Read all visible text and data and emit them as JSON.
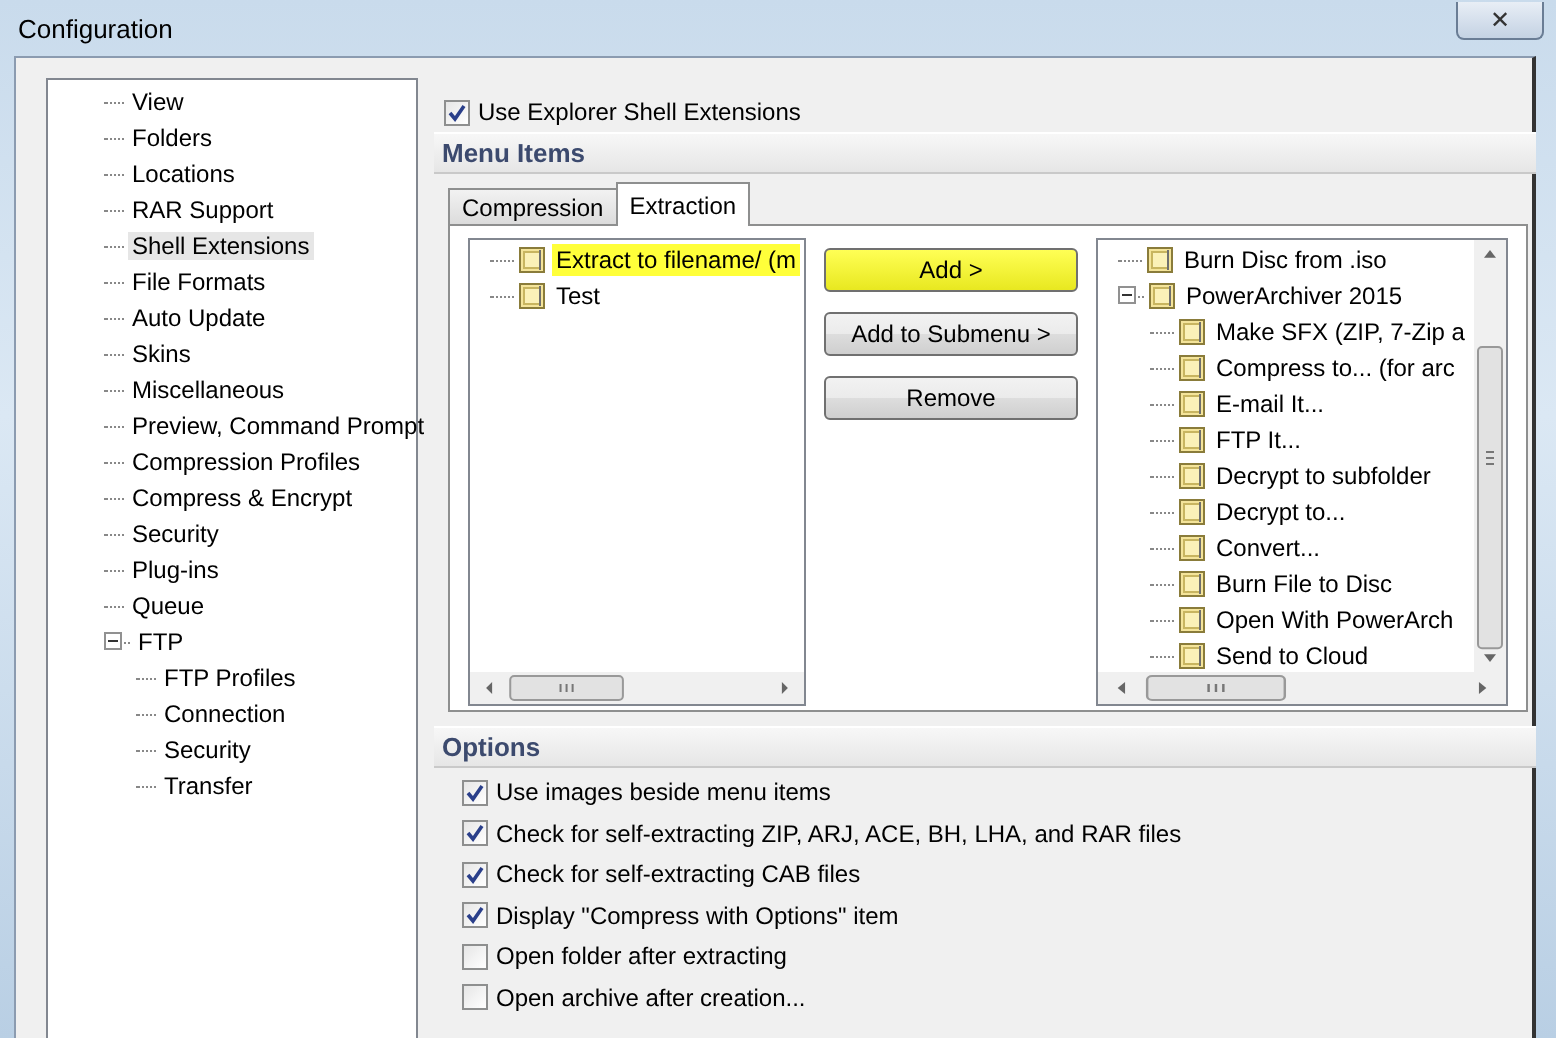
{
  "window": {
    "title": "Configuration",
    "close": "✕"
  },
  "sidebar": {
    "items": [
      {
        "label": "View",
        "selected": false
      },
      {
        "label": "Folders",
        "selected": false
      },
      {
        "label": "Locations",
        "selected": false
      },
      {
        "label": "RAR Support",
        "selected": false
      },
      {
        "label": "Shell Extensions",
        "selected": true
      },
      {
        "label": "File Formats",
        "selected": false
      },
      {
        "label": "Auto Update",
        "selected": false
      },
      {
        "label": "Skins",
        "selected": false
      },
      {
        "label": "Miscellaneous",
        "selected": false
      },
      {
        "label": "Preview, Command Prompt",
        "selected": false
      },
      {
        "label": "Compression Profiles",
        "selected": false
      },
      {
        "label": "Compress & Encrypt",
        "selected": false
      },
      {
        "label": "Security",
        "selected": false
      },
      {
        "label": "Plug-ins",
        "selected": false
      },
      {
        "label": "Queue",
        "selected": false
      },
      {
        "label": "FTP",
        "selected": false,
        "expanded": true,
        "children": [
          {
            "label": "FTP Profiles",
            "selected": false
          },
          {
            "label": "Connection",
            "selected": false
          },
          {
            "label": "Security",
            "selected": false
          },
          {
            "label": "Transfer",
            "selected": false
          }
        ]
      }
    ]
  },
  "shell_extensions": {
    "label": "Use Explorer Shell Extensions",
    "checked": true
  },
  "menu_items": {
    "title": "Menu Items",
    "tabs": [
      {
        "label": "Compression",
        "selected": false
      },
      {
        "label": "Extraction",
        "selected": true
      }
    ],
    "available": [
      {
        "label": "Extract to filename/ (m",
        "highlighted": true
      },
      {
        "label": "Test",
        "highlighted": false
      }
    ],
    "buttons": [
      {
        "label": "Add >",
        "highlighted": true
      },
      {
        "label": "Add to Submenu >",
        "highlighted": false
      },
      {
        "label": "Remove",
        "highlighted": false
      }
    ],
    "current": [
      {
        "label": "Burn Disc from .iso"
      },
      {
        "label": "PowerArchiver 2015",
        "expanded": true,
        "children": [
          {
            "label": "Make SFX (ZIP, 7-Zip a"
          },
          {
            "label": "Compress to... (for arc"
          },
          {
            "label": "E-mail It..."
          },
          {
            "label": "FTP It..."
          },
          {
            "label": "Decrypt to subfolder"
          },
          {
            "label": "Decrypt to..."
          },
          {
            "label": "Convert..."
          },
          {
            "label": "Burn File to Disc"
          },
          {
            "label": "Open With PowerArch"
          },
          {
            "label": "Send to Cloud"
          }
        ]
      }
    ]
  },
  "options": {
    "title": "Options",
    "items": [
      {
        "label": "Use images beside menu items",
        "checked": true
      },
      {
        "label": "Check for self-extracting ZIP, ARJ, ACE, BH, LHA, and RAR files",
        "checked": true
      },
      {
        "label": "Check for self-extracting CAB files",
        "checked": true
      },
      {
        "label": "Display \"Compress with Options\" item",
        "checked": true
      },
      {
        "label": "Open folder after extracting",
        "checked": false
      },
      {
        "label": "Open archive after creation...",
        "checked": false
      }
    ]
  }
}
